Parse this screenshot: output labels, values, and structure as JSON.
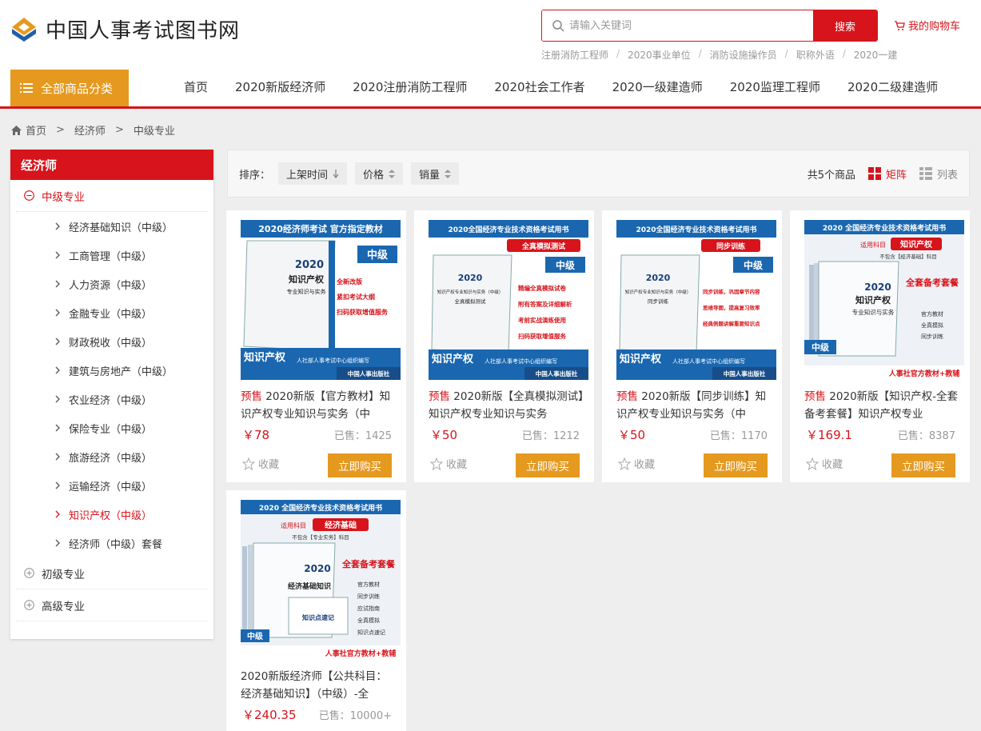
{
  "site": {
    "name": "中国人事考试图书网"
  },
  "search": {
    "placeholder": "请输入关键词",
    "button": "搜索"
  },
  "cart": {
    "label": "我的购物车"
  },
  "hot_keywords": [
    "注册消防工程师",
    "2020事业单位",
    "消防设施操作员",
    "职称外语",
    "2020一建"
  ],
  "category_button": "全部商品分类",
  "nav": [
    "首页",
    "2020新版经济师",
    "2020注册消防工程师",
    "2020社会工作者",
    "2020一级建造师",
    "2020监理工程师",
    "2020二级建造师"
  ],
  "breadcrumb": [
    "首页",
    "经济师",
    "中级专业"
  ],
  "sidebar": {
    "title": "经济师",
    "open_group": "中级专业",
    "items": [
      "经济基础知识（中级）",
      "工商管理（中级）",
      "人力资源（中级）",
      "金融专业（中级）",
      "财政税收（中级）",
      "建筑与房地产（中级）",
      "农业经济（中级）",
      "保险专业（中级）",
      "旅游经济（中级）",
      "运输经济（中级）",
      "知识产权（中级）",
      "经济师（中级）套餐"
    ],
    "active_item": "知识产权（中级）",
    "other_groups": [
      "初级专业",
      "高级专业"
    ]
  },
  "toolbar": {
    "sort_label": "排序：",
    "sorts": [
      "上架时间",
      "价格",
      "销量"
    ],
    "count": "共5个商品",
    "view_grid": "矩阵",
    "view_list": "列表"
  },
  "colors": {
    "brand_red": "#d7141b",
    "accent_orange": "#e5991f"
  },
  "products": [
    {
      "tag": "预售",
      "title": "2020新版【官方教材】知识产权专业知识与实务（中",
      "price": "￥78",
      "sold": "已售：1425",
      "fav": "收藏",
      "buy": "立即购买",
      "cover": {
        "top": "2020经济师考试 官方指定教材",
        "level": "中级",
        "year": "2020",
        "book": "知识产权",
        "book2": "专业知识与实务",
        "points": [
          "全新改版",
          "紧扣考试大纲",
          "扫码获取增值服务"
        ],
        "subject": "知识产权",
        "org": "人社部人事考试中心组织编写",
        "publisher": "中国人事出版社"
      }
    },
    {
      "tag": "预售",
      "title": "2020新版【全真模拟测试】知识产权专业知识与实务",
      "price": "￥50",
      "sold": "已售：1212",
      "fav": "收藏",
      "buy": "立即购买",
      "cover": {
        "top": "2020全国经济专业技术资格考试用书",
        "badge": "全真模拟测试",
        "level": "中级",
        "year": "2020",
        "book": "知识产权专业知识与实务（中级）",
        "book2": "全真模拟测试",
        "points": [
          "精编全真模拟试卷",
          "附有答案及详细解析",
          "考前实战演练使用",
          "扫码获取增值服务"
        ],
        "subject": "知识产权",
        "org": "人社部人事考试中心组织编写",
        "publisher": "中国人事出版社"
      }
    },
    {
      "tag": "预售",
      "title": "2020新版【同步训练】知识产权专业知识与实务（中",
      "price": "￥50",
      "sold": "已售：1170",
      "fav": "收藏",
      "buy": "立即购买",
      "cover": {
        "top": "2020全国经济专业技术资格考试用书",
        "badge": "同步训练",
        "level": "中级",
        "year": "2020",
        "book": "知识产权专业知识与实务（中级）",
        "book2": "同步训练",
        "points": [
          "同步训练，巩固章节内容",
          "思维导图，提高复习效率",
          "经典例题讲解重要知识点"
        ],
        "subject": "知识产权",
        "org": "人社部人事考试中心组织编写",
        "publisher": "中国人事出版社"
      }
    },
    {
      "tag": "预售",
      "title": "2020新版【知识产权-全套备考套餐】知识产权专业",
      "price": "￥169.1",
      "sold": "已售：8387",
      "fav": "收藏",
      "buy": "立即购买",
      "cover": {
        "top": "2020 全国经济专业技术资格考试用书",
        "subject_label": "适用科目",
        "subject": "知识产权",
        "note": "不包含【经济基础】科目",
        "year": "2020",
        "book": "知识产权",
        "book2": "专业知识与实务",
        "set": "全套备考套餐",
        "items": [
          "官方教材",
          "全真模拟",
          "同步训练"
        ],
        "level": "中级",
        "footer": "人事社官方教材+教辅"
      }
    },
    {
      "tag": "",
      "title": "2020新版经济师【公共科目：经济基础知识】（中级）-全",
      "price": "￥240.35",
      "sold": "已售：10000+",
      "fav": "收藏",
      "buy": "立即购买",
      "cover": {
        "top": "2020 全国经济专业技术资格考试用书",
        "subject_label": "适用科目",
        "subject": "经济基础",
        "note": "不包含【专业实务】科目",
        "year": "2020",
        "book": "经济基础知识",
        "book2": "知识点速记",
        "set": "全套备考套餐",
        "items": [
          "官方教材",
          "同步训练",
          "应试指南",
          "全真模拟",
          "知识点速记"
        ],
        "level": "中级",
        "footer": "人事社官方教材+教辅"
      }
    }
  ]
}
